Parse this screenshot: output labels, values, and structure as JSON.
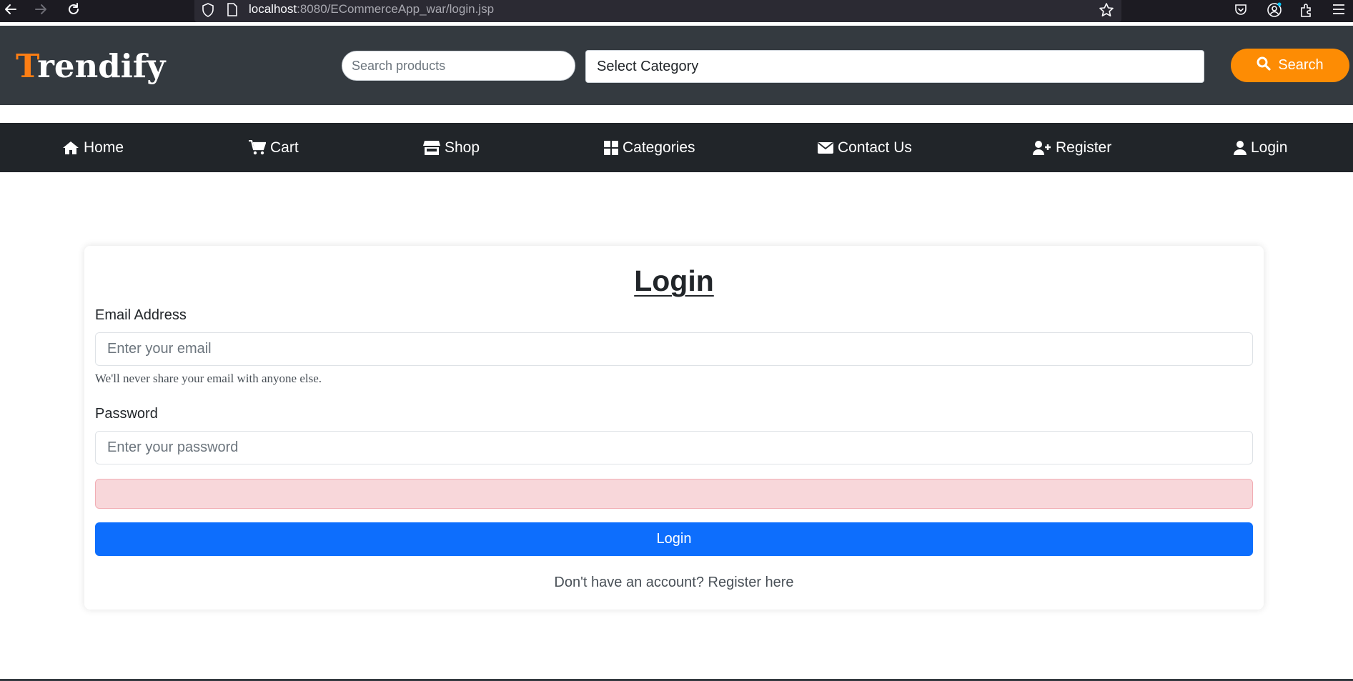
{
  "browser": {
    "url_host": "localhost",
    "url_rest": ":8080/ECommerceApp_war/login.jsp"
  },
  "header": {
    "brand_first": "T",
    "brand_rest": "rendify",
    "search_placeholder": "Search products",
    "category_select": "Select Category",
    "search_button": "Search"
  },
  "nav": {
    "items": [
      {
        "label": "Home",
        "icon": "home-icon"
      },
      {
        "label": "Cart",
        "icon": "cart-icon"
      },
      {
        "label": "Shop",
        "icon": "store-icon"
      },
      {
        "label": "Categories",
        "icon": "grid-icon"
      },
      {
        "label": "Contact Us",
        "icon": "envelope-icon"
      },
      {
        "label": "Register",
        "icon": "user-plus-icon"
      },
      {
        "label": "Login",
        "icon": "user-icon"
      }
    ]
  },
  "login_form": {
    "title": "Login",
    "email_label": "Email Address",
    "email_placeholder": "Enter your email",
    "email_help": "We'll never share your email with anyone else.",
    "password_label": "Password",
    "password_placeholder": "Enter your password",
    "submit_label": "Login",
    "register_text": "Don't have an account? Register here"
  },
  "colors": {
    "brand_accent": "#fd7e14",
    "header_bg": "#343a40",
    "nav_bg": "#212529",
    "primary": "#0d6efd",
    "search_button": "#fd8c04",
    "alert_bg": "#f8d7da"
  }
}
